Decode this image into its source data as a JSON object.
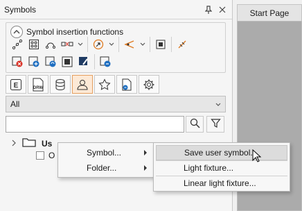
{
  "panel": {
    "title": "Symbols",
    "pin_icon": "pin-icon",
    "close_icon": "close-icon"
  },
  "group": {
    "label": "Symbol insertion functions"
  },
  "tabs": [
    {
      "name": "tab-e",
      "label": "E"
    },
    {
      "name": "tab-drw",
      "label": "DRW"
    },
    {
      "name": "tab-database"
    },
    {
      "name": "tab-user",
      "active": true
    },
    {
      "name": "tab-favorites"
    },
    {
      "name": "tab-document"
    },
    {
      "name": "tab-settings"
    }
  ],
  "filter": {
    "selected": "All"
  },
  "search": {
    "value": ""
  },
  "tree": {
    "node_label": "Us",
    "child_label": "O"
  },
  "context_menu": {
    "items": [
      {
        "label": "Symbol...",
        "has_submenu": true
      },
      {
        "label": "Folder...",
        "has_submenu": true
      }
    ]
  },
  "submenu": {
    "items": [
      {
        "label": "Save user symbol...",
        "highlighted": true
      },
      {
        "label": "Light fixture..."
      },
      {
        "label": "Linear light fixture..."
      }
    ]
  },
  "document_tab": {
    "label": "Start Page"
  },
  "colors": {
    "accent_orange": "#e07b22",
    "accent_blue": "#1f6fc1",
    "accent_red": "#d93025",
    "active_tab_bg": "#fde9d6"
  }
}
